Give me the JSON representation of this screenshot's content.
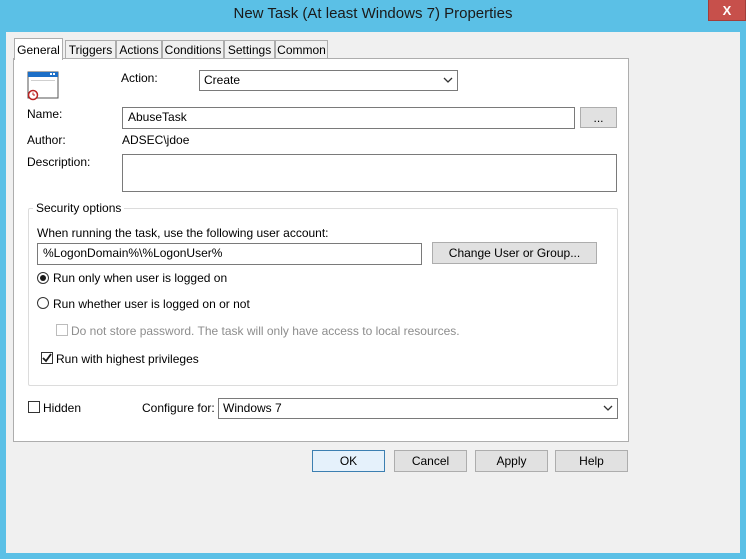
{
  "window": {
    "title": "New Task (At least Windows 7) Properties",
    "close_glyph": "X"
  },
  "tabs": [
    {
      "label": "General",
      "active": true
    },
    {
      "label": "Triggers",
      "active": false
    },
    {
      "label": "Actions",
      "active": false
    },
    {
      "label": "Conditions",
      "active": false
    },
    {
      "label": "Settings",
      "active": false
    },
    {
      "label": "Common",
      "active": false
    }
  ],
  "general": {
    "action_label": "Action:",
    "action_value": "Create",
    "name_label": "Name:",
    "name_value": "AbuseTask",
    "browse_label": "...",
    "author_label": "Author:",
    "author_value": "ADSEC\\jdoe",
    "description_label": "Description:",
    "description_value": ""
  },
  "security": {
    "group_title": "Security options",
    "account_prompt": "When running the task, use the following user account:",
    "account_value": "%LogonDomain%\\%LogonUser%",
    "change_user_label": "Change User or Group...",
    "radio_logged_on": "Run only when user is logged on",
    "radio_whether": "Run whether user is logged on or not",
    "no_store_password": "Do not store password. The task will only have access to local resources.",
    "highest_privileges": "Run with highest privileges",
    "selected_radio": "logged_on",
    "highest_privileges_checked": true,
    "no_store_password_checked": false
  },
  "bottom": {
    "hidden_label": "Hidden",
    "hidden_checked": false,
    "configure_label": "Configure for:",
    "configure_value": "Windows 7"
  },
  "buttons": {
    "ok": "OK",
    "cancel": "Cancel",
    "apply": "Apply",
    "help": "Help"
  },
  "colors": {
    "titlebar": "#5bc0e6",
    "close": "#c7504b",
    "default_button_border": "#3c7fb1"
  }
}
